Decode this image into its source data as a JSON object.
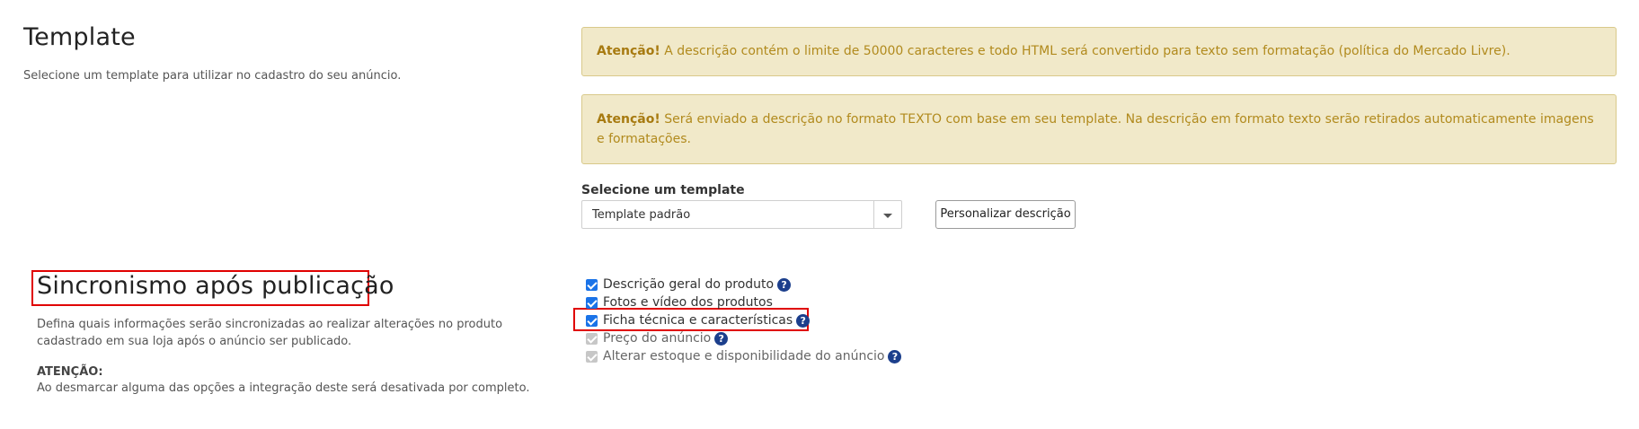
{
  "template_section": {
    "title": "Template",
    "description": "Selecione um template para utilizar no cadastro do seu anúncio."
  },
  "alerts": [
    {
      "strong": "Atenção!",
      "text": " A descrição contém o limite de 50000 caracteres e todo HTML será convertido para texto sem formatação (política do Mercado Livre)."
    },
    {
      "strong": "Atenção!",
      "text": " Será enviado a descrição no formato TEXTO com base em seu template. Na descrição em formato texto serão retirados automaticamente imagens e formatações."
    }
  ],
  "template_select": {
    "label": "Selecione um template",
    "value": "Template padrão"
  },
  "customize_button": "Personalizar descrição",
  "sync_section": {
    "title": "Sincronismo após publicação",
    "description": "Defina quais informações serão sincronizadas ao realizar alterações no produto cadastrado em sua loja após o anúncio ser publicado.",
    "warning_label": "ATENÇÃO:",
    "warning_text": "Ao desmarcar alguma das opções a integração deste será desativada por completo."
  },
  "sync_options": [
    {
      "label": "Descrição geral do produto",
      "checked": true,
      "disabled": false,
      "help": true
    },
    {
      "label": "Fotos e vídeo dos produtos",
      "checked": true,
      "disabled": false,
      "help": false
    },
    {
      "label": "Ficha técnica e características",
      "checked": true,
      "disabled": false,
      "help": true
    },
    {
      "label": "Preço do anúncio",
      "checked": true,
      "disabled": true,
      "help": true
    },
    {
      "label": "Alterar estoque e disponibilidade do anúncio",
      "checked": true,
      "disabled": true,
      "help": true
    }
  ],
  "help_glyph": "?",
  "colors": {
    "alert_bg": "#f1e9c9",
    "alert_text": "#b18a1d",
    "highlight": "#e00000",
    "checkbox": "#1a73e8",
    "help_icon": "#1c3f8c"
  }
}
